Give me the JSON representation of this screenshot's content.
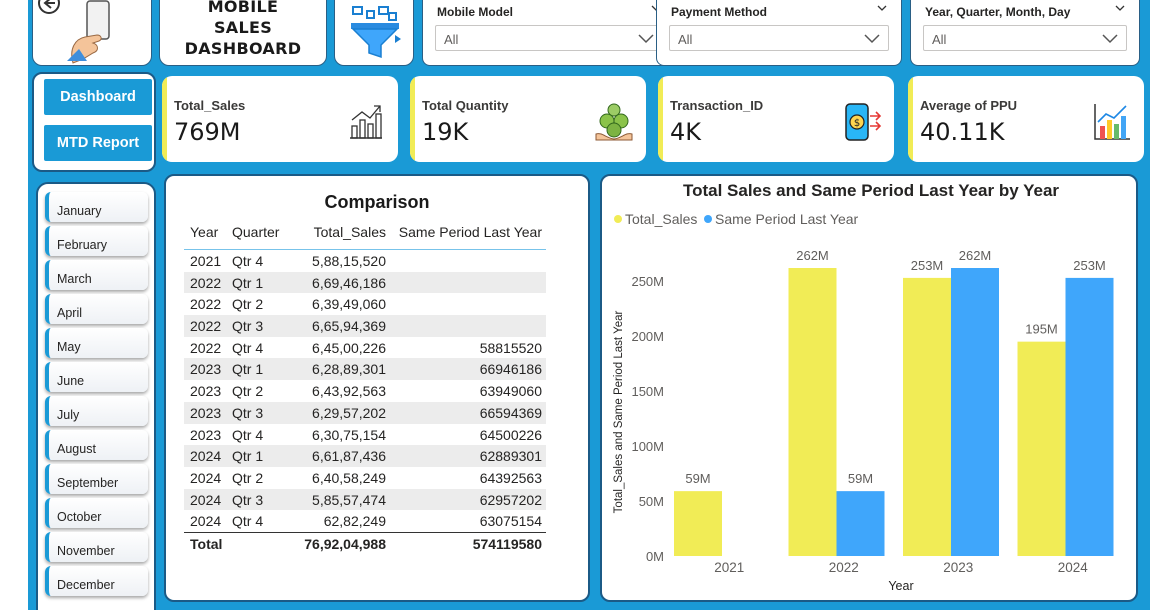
{
  "header": {
    "title": "MOBILE SALES DASHBOARD",
    "slicers": [
      {
        "label": "Mobile Model",
        "value": "All"
      },
      {
        "label": "Payment Method",
        "value": "All"
      },
      {
        "label": "Year, Quarter, Month, Day",
        "value": "All"
      }
    ]
  },
  "nav": {
    "dashboard_label": "Dashboard",
    "mtd_label": "MTD Report"
  },
  "kpis": [
    {
      "name": "Total_Sales",
      "value": "769M",
      "icon": "growth-chart-icon"
    },
    {
      "name": "Total Quantity",
      "value": "19K",
      "icon": "money-bags-icon"
    },
    {
      "name": "Transaction_ID",
      "value": "4K",
      "icon": "mobile-payment-icon"
    },
    {
      "name": "Average of PPU",
      "value": "40.11K",
      "icon": "bar-chart-icon"
    }
  ],
  "months": [
    "January",
    "February",
    "March",
    "April",
    "May",
    "June",
    "July",
    "August",
    "September",
    "October",
    "November",
    "December"
  ],
  "table": {
    "title": "Comparison",
    "headers": [
      "Year",
      "Quarter",
      "Total_Sales",
      "Same Period Last Year"
    ],
    "rows": [
      [
        "2021",
        "Qtr 4",
        "5,88,15,520",
        ""
      ],
      [
        "2022",
        "Qtr 1",
        "6,69,46,186",
        ""
      ],
      [
        "2022",
        "Qtr 2",
        "6,39,49,060",
        ""
      ],
      [
        "2022",
        "Qtr 3",
        "6,65,94,369",
        ""
      ],
      [
        "2022",
        "Qtr 4",
        "6,45,00,226",
        "58815520"
      ],
      [
        "2023",
        "Qtr 1",
        "6,28,89,301",
        "66946186"
      ],
      [
        "2023",
        "Qtr 2",
        "6,43,92,563",
        "63949060"
      ],
      [
        "2023",
        "Qtr 3",
        "6,29,57,202",
        "66594369"
      ],
      [
        "2023",
        "Qtr 4",
        "6,30,75,154",
        "64500226"
      ],
      [
        "2024",
        "Qtr 1",
        "6,61,87,436",
        "62889301"
      ],
      [
        "2024",
        "Qtr 2",
        "6,40,58,249",
        "64392563"
      ],
      [
        "2024",
        "Qtr 3",
        "5,85,57,474",
        "62957202"
      ],
      [
        "2024",
        "Qtr 4",
        "62,82,249",
        "63075154"
      ]
    ],
    "total": {
      "label": "Total",
      "sales": "76,92,04,988",
      "spl": "574119580"
    }
  },
  "colors": {
    "accent": "#1a9ad6",
    "yellow": "#f1ec56",
    "blue": "#3fa6fb",
    "dark_border": "#1b5a86"
  },
  "chart_data": {
    "type": "bar",
    "title": "Total Sales and Same Period Last Year by Year",
    "xlabel": "Year",
    "ylabel": "Total_Sales and Same Period Last Year",
    "categories": [
      "2021",
      "2022",
      "2023",
      "2024"
    ],
    "series": [
      {
        "name": "Total_Sales",
        "color": "#f1ec56",
        "values": [
          59,
          262,
          253,
          195
        ],
        "labels": [
          "59M",
          "262M",
          "253M",
          "195M"
        ]
      },
      {
        "name": "Same Period Last Year",
        "color": "#3fa6fb",
        "values": [
          null,
          59,
          262,
          253
        ],
        "labels": [
          "",
          "59M",
          "262M",
          "253M"
        ]
      }
    ],
    "ylim": [
      0,
      262
    ],
    "yticks": [
      0,
      50,
      100,
      150,
      200,
      250
    ],
    "ytick_labels": [
      "0M",
      "50M",
      "100M",
      "150M",
      "200M",
      "250M"
    ],
    "legend": "top-left",
    "grid": false
  }
}
